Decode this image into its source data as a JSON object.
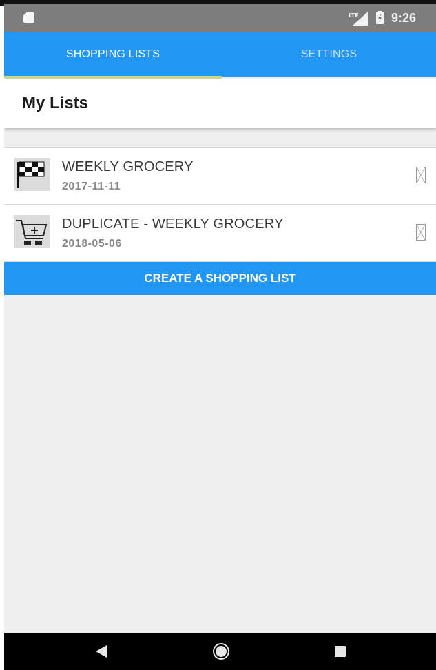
{
  "status_bar": {
    "time": "9:26",
    "network_label": "LTE",
    "icons": [
      "sd-card-icon",
      "lte-signal-icon",
      "battery-charging-icon"
    ]
  },
  "tabs": [
    {
      "label": "SHOPPING LISTS",
      "selected": true
    },
    {
      "label": "SETTINGS",
      "selected": false
    }
  ],
  "header": {
    "title": "My Lists"
  },
  "lists": [
    {
      "name": "WEEKLY GROCERY",
      "date": "2017-11-11",
      "icon": "checkered-flag-icon"
    },
    {
      "name": "DUPLICATE - WEEKLY GROCERY",
      "date": "2018-05-06",
      "icon": "shopping-cart-icon"
    }
  ],
  "create_button": {
    "label": "CREATE A SHOPPING LIST"
  },
  "nav_bar": {
    "icons": [
      "back-icon",
      "home-icon",
      "recents-icon"
    ]
  },
  "colors": {
    "primary": "#2196f3",
    "tab_indicator": "#c9d88a",
    "background": "#efefef",
    "status_bar": "#7d7d7d",
    "nav_bar": "#000000"
  }
}
